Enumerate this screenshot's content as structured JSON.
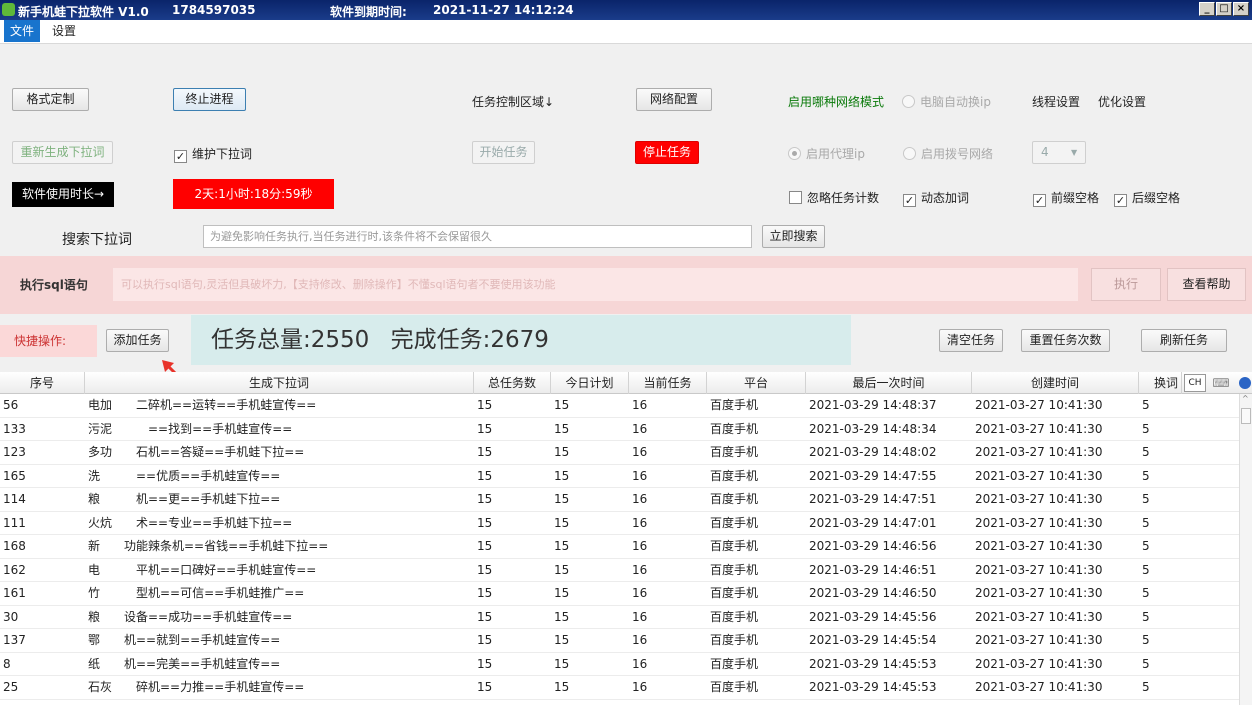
{
  "window": {
    "title": "新手机蛙下拉软件 V1.0",
    "id": "1784597035",
    "expiry_label": "软件到期时间:",
    "expiry_value": "2021-11-27 14:12:24",
    "controls": [
      "_",
      "□",
      "×"
    ]
  },
  "menu": {
    "file": "文件",
    "settings": "设置"
  },
  "controls": {
    "format_button": "格式定制",
    "stop_process_button": "终止进程",
    "task_control_label": "任务控制区域↓",
    "network_config_button": "网络配置",
    "network_mode_label": "启用哪种网络模式",
    "auto_ip_radio": "电脑自动换ip",
    "thread_settings": "线程设置",
    "optimize_settings": "优化设置",
    "regen_button": "重新生成下拉词",
    "maintain_checkbox": "维护下拉词",
    "start_task_button": "开始任务",
    "stop_task_button": "停止任务",
    "proxy_radio": "启用代理ip",
    "dialup_radio": "启用拨号网络",
    "thread_count": "4",
    "usage_label": "软件使用时长→",
    "usage_value": "2天:1小时:18分:59秒",
    "ignore_count_checkbox": "忽略任务计数",
    "dynamic_word_checkbox": "动态加词",
    "prefix_space_checkbox": "前缀空格",
    "suffix_space_checkbox": "后缀空格",
    "search_label": "搜索下拉词",
    "search_placeholder": "为避免影响任务执行,当任务进行时,该条件将不会保留很久",
    "search_button": "立即搜索"
  },
  "sql": {
    "label": "执行sql语句",
    "placeholder": "可以执行sql语句,灵活但具破坏力,【支持修改、删除操作】不懂sql语句者不要使用该功能",
    "execute_button": "执行",
    "help_button": "查看帮助"
  },
  "quick": {
    "label": "快捷操作:",
    "add_task_button": "添加任务",
    "total_label": "任务总量:2550",
    "done_label": "完成任务:2679",
    "clear_button": "清空任务",
    "reset_button": "重置任务次数",
    "refresh_button": "刷新任务"
  },
  "table": {
    "columns": [
      "序号",
      "生成下拉词",
      "总任务数",
      "今日计划",
      "当前任务",
      "平台",
      "最后一次时间",
      "创建时间",
      "换词"
    ],
    "header_extra": "CH",
    "rows": [
      [
        "56",
        "电加　　二碎机==运转==手机蛙宣传==",
        "15",
        "15",
        "16",
        "百度手机",
        "2021-03-29 14:48:37",
        "2021-03-27 10:41:30",
        "5"
      ],
      [
        "133",
        "污泥　　　==找到==手机蛙宣传==",
        "15",
        "15",
        "16",
        "百度手机",
        "2021-03-29 14:48:34",
        "2021-03-27 10:41:30",
        "5"
      ],
      [
        "123",
        "多功　　石机==答疑==手机蛙下拉==",
        "15",
        "15",
        "16",
        "百度手机",
        "2021-03-29 14:48:02",
        "2021-03-27 10:41:30",
        "5"
      ],
      [
        "165",
        "洗　　　==优质==手机蛙宣传==",
        "15",
        "15",
        "16",
        "百度手机",
        "2021-03-29 14:47:55",
        "2021-03-27 10:41:30",
        "5"
      ],
      [
        "114",
        "粮　　　机==更==手机蛙下拉==",
        "15",
        "15",
        "16",
        "百度手机",
        "2021-03-29 14:47:51",
        "2021-03-27 10:41:30",
        "5"
      ],
      [
        "111",
        "火炕　　术==专业==手机蛙下拉==",
        "15",
        "15",
        "16",
        "百度手机",
        "2021-03-29 14:47:01",
        "2021-03-27 10:41:30",
        "5"
      ],
      [
        "168",
        "新　　功能辣条机==省钱==手机蛙下拉==",
        "15",
        "15",
        "16",
        "百度手机",
        "2021-03-29 14:46:56",
        "2021-03-27 10:41:30",
        "5"
      ],
      [
        "162",
        "电　　　平机==口碑好==手机蛙宣传==",
        "15",
        "15",
        "16",
        "百度手机",
        "2021-03-29 14:46:51",
        "2021-03-27 10:41:30",
        "5"
      ],
      [
        "161",
        "竹　　　型机==可信==手机蛙推广==",
        "15",
        "15",
        "16",
        "百度手机",
        "2021-03-29 14:46:50",
        "2021-03-27 10:41:30",
        "5"
      ],
      [
        "30",
        "粮　　设备==成功==手机蛙宣传==",
        "15",
        "15",
        "16",
        "百度手机",
        "2021-03-29 14:45:56",
        "2021-03-27 10:41:30",
        "5"
      ],
      [
        "137",
        "鄂　　机==就到==手机蛙宣传==",
        "15",
        "15",
        "16",
        "百度手机",
        "2021-03-29 14:45:54",
        "2021-03-27 10:41:30",
        "5"
      ],
      [
        "8",
        "纸　　机==完美==手机蛙宣传==",
        "15",
        "15",
        "16",
        "百度手机",
        "2021-03-29 14:45:53",
        "2021-03-27 10:41:30",
        "5"
      ],
      [
        "25",
        "石灰　　碎机==力推==手机蛙宣传==",
        "15",
        "15",
        "16",
        "百度手机",
        "2021-03-29 14:45:53",
        "2021-03-27 10:41:30",
        "5"
      ]
    ]
  }
}
